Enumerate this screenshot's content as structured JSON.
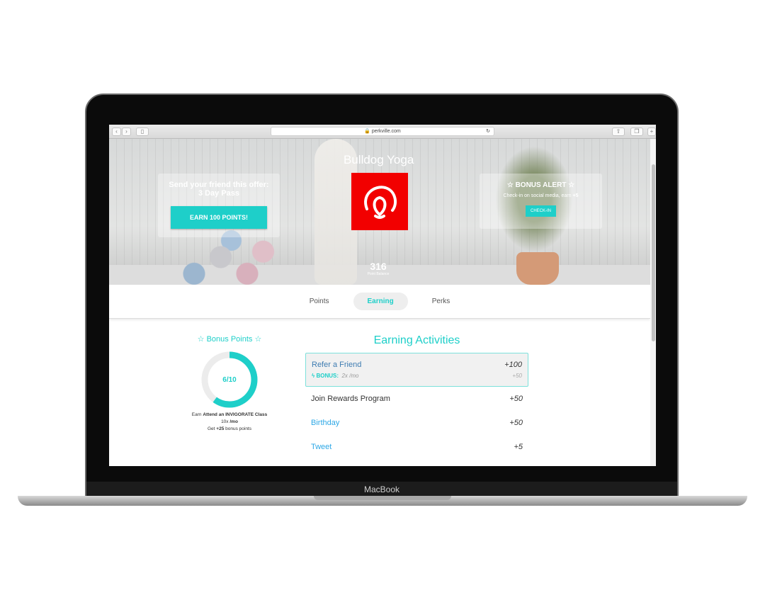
{
  "device": {
    "label": "MacBook"
  },
  "browser": {
    "url": "perkville.com"
  },
  "hero": {
    "business_name": "Bulldog Yoga",
    "offer_title": "Send your friend this offer:",
    "offer_name": "3 Day Pass",
    "offer_button": "EARN 100 POINTS!",
    "alert_title": "☆ BONUS ALERT ☆",
    "alert_text": "Check-in on social media, earn",
    "alert_points": "+5",
    "alert_button": "CHECK-IN",
    "point_balance": "316",
    "point_balance_label": "Point Balance",
    "logo_color": "#f20000"
  },
  "tabs": [
    {
      "label": "Points"
    },
    {
      "label": "Earning",
      "active": true
    },
    {
      "label": "Perks"
    }
  ],
  "bonus": {
    "title": "☆ Bonus Points ☆",
    "progress_label": "6/10",
    "progress": 0.6,
    "earn_prefix": "Earn",
    "activity": "Attend an INVIGORATE Class",
    "freq_count": "10x",
    "freq_unit": "/mo",
    "get_prefix": "Get",
    "bonus_pts": "+25",
    "get_suffix": "bonus points"
  },
  "activities": {
    "title": "Earning Activities",
    "items": [
      {
        "name": "Refer a Friend",
        "points": "+100",
        "bonus_label": "BONUS:",
        "bonus_freq": "2x /mo",
        "bonus_points": "+50"
      },
      {
        "name": "Join Rewards Program",
        "points": "+50"
      },
      {
        "name": "Birthday",
        "points": "+50"
      },
      {
        "name": "Tweet",
        "points": "+5"
      }
    ]
  },
  "colors": {
    "accent": "#1ecfc9",
    "link": "#2ea8e6"
  }
}
